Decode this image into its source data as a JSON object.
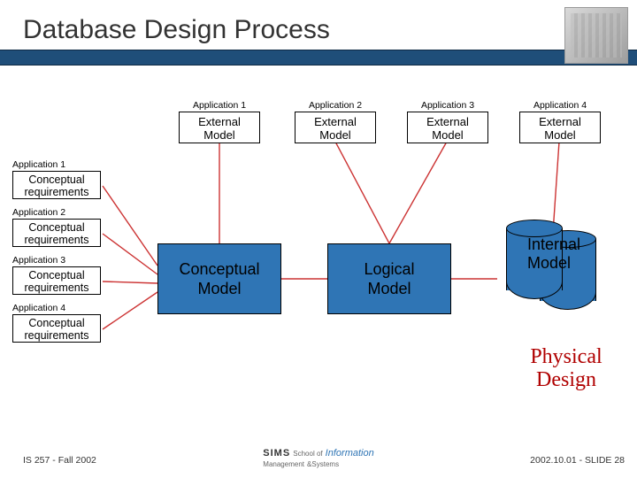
{
  "title": "Database Design Process",
  "apps": [
    {
      "label": "Application 1",
      "ext": "External\nModel"
    },
    {
      "label": "Application 2",
      "ext": "External\nModel"
    },
    {
      "label": "Application 3",
      "ext": "External\nModel"
    },
    {
      "label": "Application 4",
      "ext": "External\nModel"
    }
  ],
  "reqs": [
    {
      "label": "Application 1",
      "box": "Conceptual\nrequirements"
    },
    {
      "label": "Application 2",
      "box": "Conceptual\nrequirements"
    },
    {
      "label": "Application 3",
      "box": "Conceptual\nrequirements"
    },
    {
      "label": "Application 4",
      "box": "Conceptual\nrequirements"
    }
  ],
  "conceptual": "Conceptual\nModel",
  "logical": "Logical\nModel",
  "internal": "Internal\nModel",
  "physical": "Physical\nDesign",
  "footer": {
    "left": "IS 257 - Fall 2002",
    "right": "2002.10.01 - SLIDE 28",
    "sims": "SIMS",
    "school_small": "School of",
    "info": "Information",
    "mgmt_small": "Management",
    "sys": "&Systems"
  },
  "colors": {
    "bar": "#1f4e79",
    "box": "#2f75b5",
    "phys": "#b00000"
  }
}
